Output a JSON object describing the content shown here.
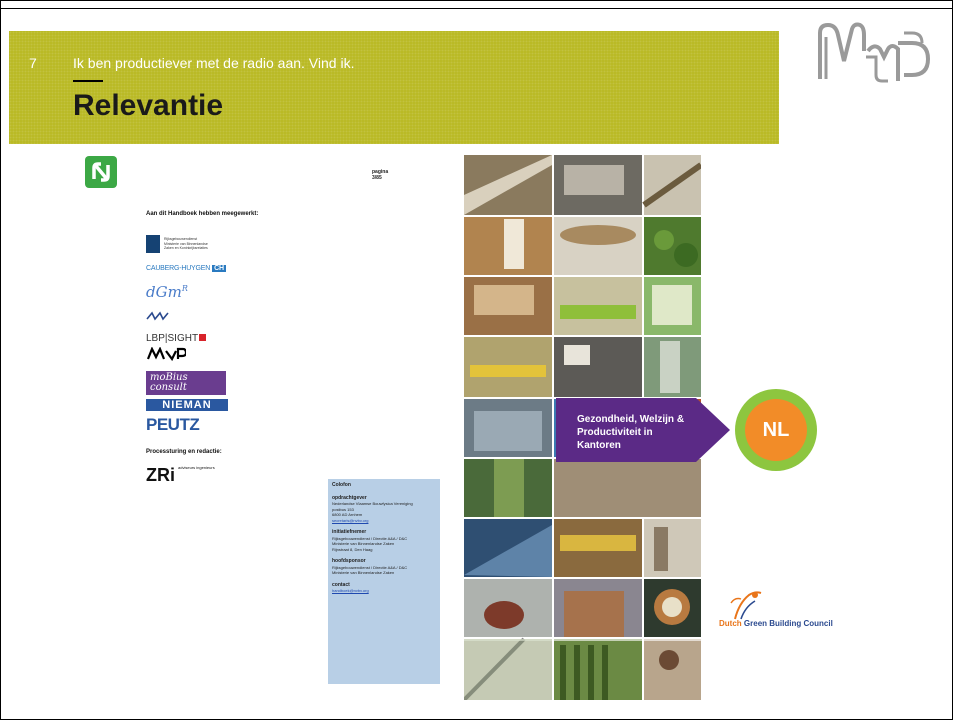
{
  "header": {
    "slide_number": "7",
    "subtitle": "Ik ben productiever met de radio aan. Vind ik.",
    "title": "Relevantie"
  },
  "document": {
    "page_label": "pagina",
    "page_number": "3/85",
    "contributors_heading": "Aan dit Handboek hebben meegewerkt:",
    "contributor_logos": {
      "rijksgebouwendienst": "Rijksgebouwendienst Ministerie van Binnenlandse Zaken en Koninkrijksrelaties",
      "cauberg": "CAUBERG-HUYGEN",
      "cauberg_mark": "CH",
      "dgmr": "dGm",
      "dgmr_sup": "R",
      "lbp": "LBP|SIGHT",
      "mvp": "MVP",
      "mobius": "moBius consult",
      "nieman": "NIEMAN",
      "peutz": "PEUTZ"
    },
    "process_heading": "Processturing en redactie:",
    "zri": "ZRi",
    "zri_sub": "adviseurs ingenieurs",
    "colofon": {
      "title": "Colofon",
      "client_heading": "opdrachtgever",
      "client_lines": [
        "Nederlandse Vlaamse Bouwfysica Vereniging",
        "postbus 153",
        "6800 AD Arnhem"
      ],
      "client_email": "secretaris@nvbv.org",
      "initiator_heading": "initiatiefnemer",
      "initiator_lines": [
        "Rijksgebouwendienst / Directie A&A / D&C",
        "Ministerie van Binnenlandse Zaken",
        "Rijnstraat 8, Den Haag"
      ],
      "sponsor_heading": "hoofdsponsor",
      "sponsor_lines": [
        "Rijksgebouwendienst / Directie A&A / D&C",
        "Ministerie van Binnenlandse Zaken"
      ],
      "contact_heading": "contact",
      "contact_email": "handboek@nvbv.org"
    }
  },
  "cover": {
    "banner_line1": "Gezondheid, Welzijn &",
    "banner_line2": "Productiviteit in Kantoren",
    "badge": "NL",
    "banner_color": "#5b2a86",
    "badge_outer_color": "#8dc63f",
    "badge_inner_color": "#f28c28"
  },
  "sponsor_logo": {
    "dutch": "Dutch",
    "rest": "Green Building Council"
  },
  "colors": {
    "band": "#b8b820",
    "title_text": "#1a1a1a"
  }
}
